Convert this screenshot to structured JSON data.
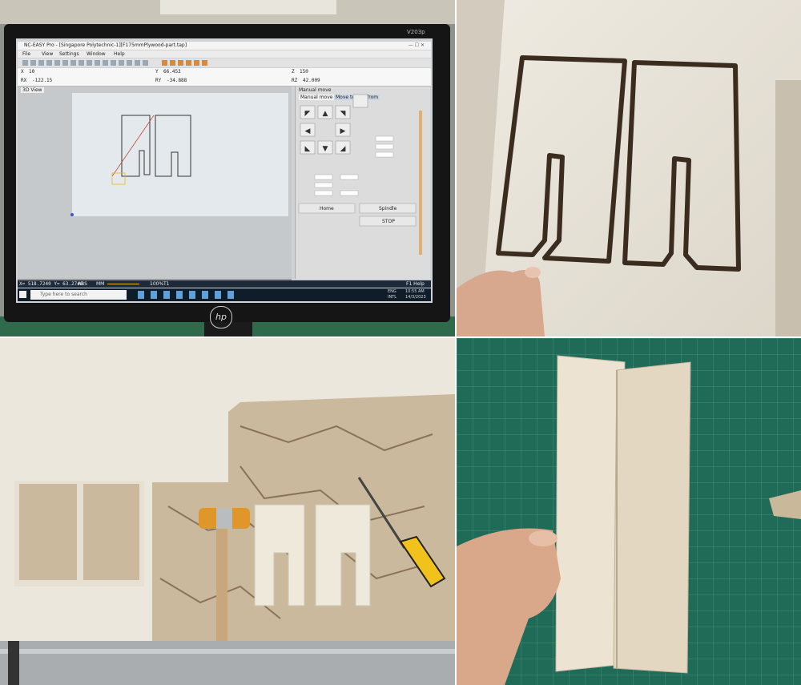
{
  "monitor": {
    "brand": "V203p",
    "logo": "hp",
    "window_title": "NC-EASY Pro - [Singapore Polytechnic-1][F175mmPlywood-part.tap]",
    "menu_items": [
      "File",
      "View",
      "Settings",
      "Window",
      "Help"
    ],
    "tab_label": "3D View",
    "coords": {
      "x_label": "X",
      "x_value": "10",
      "y_label": "Y",
      "y_value": "66.453",
      "z_label": "Z",
      "z_value": "150",
      "rx_label": "RX",
      "rx_value": "-122.15",
      "ry_label": "RY",
      "ry_value": "-34.888",
      "rz_label": "RZ",
      "rz_value": "42.009"
    },
    "manual_move": {
      "title": "Manual move",
      "tab1": "Manual move",
      "tab2": "Move to and from",
      "home_label": "Home",
      "spindle_label": "Spindle",
      "stop_label": "STOP"
    },
    "status_bar": {
      "coords": "X= 518.7240 Y= 63.2740",
      "abs": "ABS",
      "mm": "MM",
      "zoom": "100%",
      "tool": "T1",
      "f1": "F1 Help"
    },
    "taskbar": {
      "search_placeholder": "Type here to search",
      "time": "10:55 AM",
      "date": "14/3/2023",
      "lang1": "ENG",
      "lang2": "INTL"
    }
  },
  "colors": {
    "plywood": "#e9e4d9",
    "cut_groove": "#3b2c20",
    "cutting_mat": "#1f6b58",
    "mallet_head": "#e0962a",
    "screwdriver_handle": "#f1c21b"
  }
}
